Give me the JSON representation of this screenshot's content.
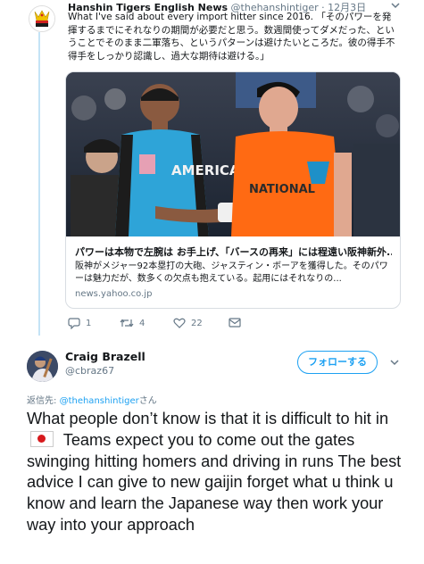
{
  "tweet": {
    "author_name": "Hanshin Tigers English News",
    "author_handle": "@thehanshintiger",
    "separator": "·",
    "date": "12月3日",
    "text": "What I've said about every import hitter since 2016. 「そのパワーを発揮するまでにそれなりの期間が必要だと思う。数週間使ってダメだった、ということでそのまま二軍落ち、というパターンは避けたいところだ。彼の得手不得手をしっかり認識し、過大な期待は避ける。」",
    "card": {
      "title": "パワーは本物で左腕は お手上げ、「バースの再来」には程遠い阪神新外...",
      "description": "阪神がメジャー92本塁打の大砲、ジャスティン・ボーアを獲得した。そのパワーは魅力だが、数多くの欠点も抱えている。起用にはそれなりの...",
      "domain": "news.yahoo.co.jp",
      "photo_left_jersey": "AMERICAN",
      "photo_right_jersey": "NATIONAL"
    },
    "actions": {
      "replies": "1",
      "retweets": "4",
      "likes": "22"
    }
  },
  "reply": {
    "author_name": "Craig Brazell",
    "author_handle": "@cbraz67",
    "follow_label": "フォローする",
    "reply_to_prefix": "返信先: ",
    "reply_to_handle": "@thehanshintiger",
    "reply_to_suffix": "さん",
    "text_before_flag": "What people don’t know is that it is difficult to hit in",
    "flag_icon": "japan-flag-icon",
    "text_after_flag": " Teams expect you to come out the gates swinging hitting homers and driving in runs  The best advice I can give to new gaijin forget what u think u know and learn the Japanese way then work your way into your approach"
  },
  "colors": {
    "accent": "#1da1f2",
    "muted": "#657786",
    "thread_line": "#c4e3f6"
  }
}
